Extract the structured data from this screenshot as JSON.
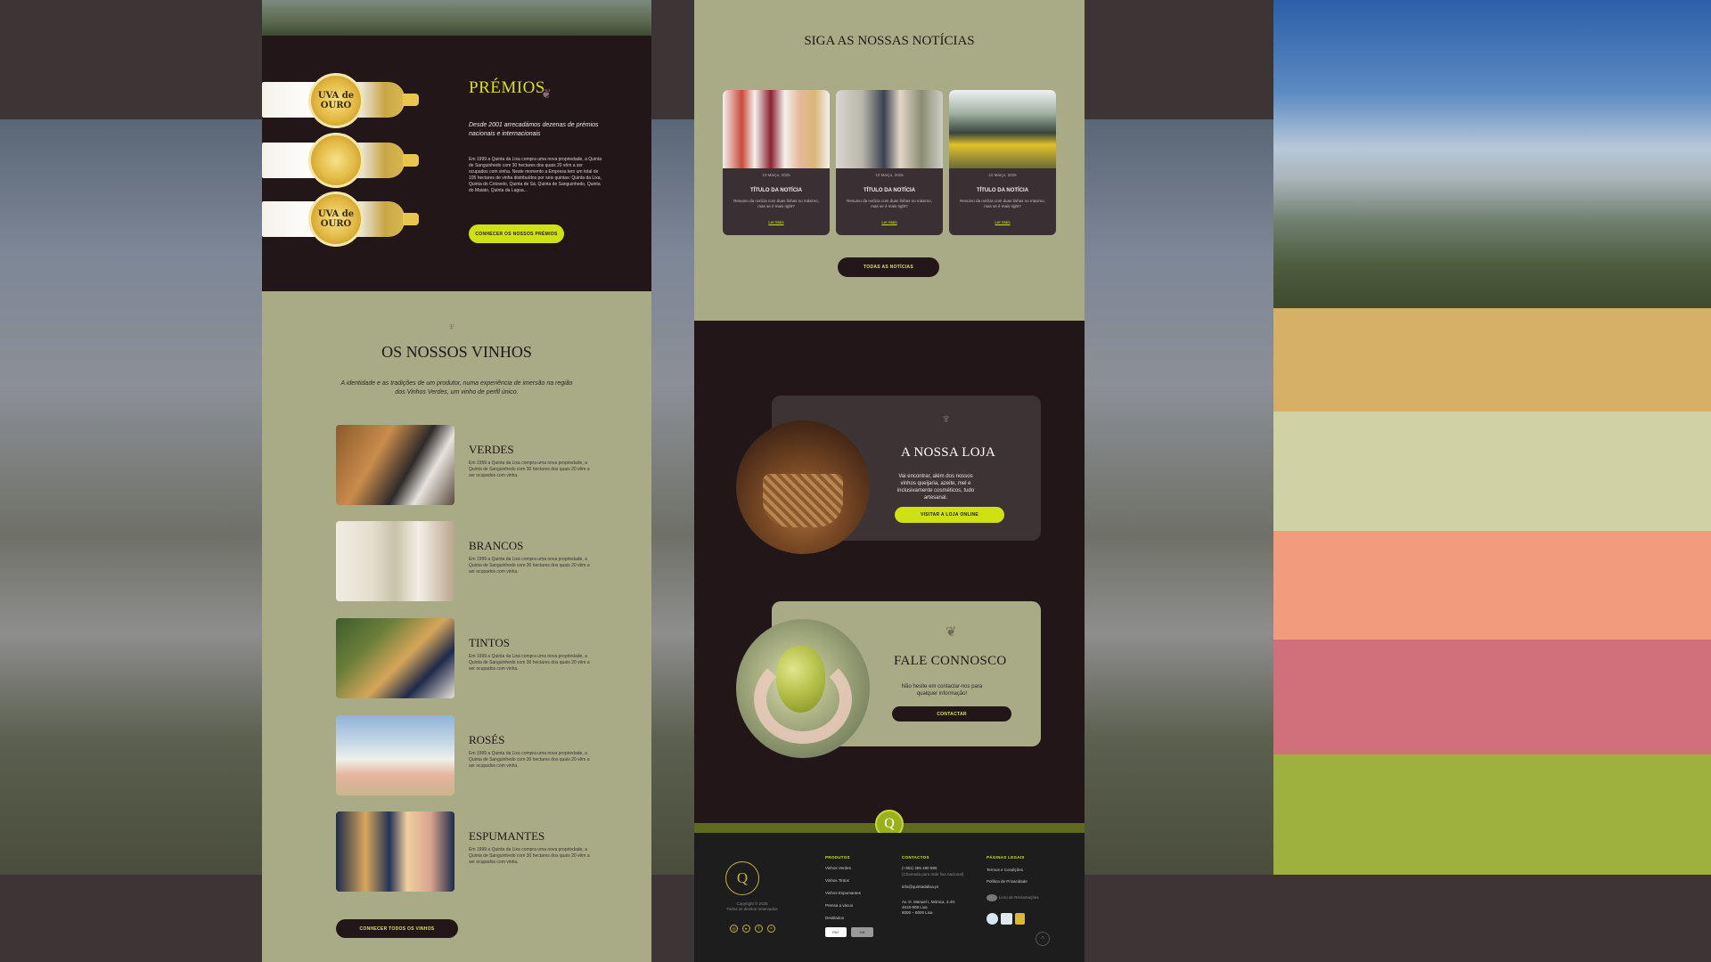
{
  "colors": {
    "dark": "#221619",
    "sage": "#a9aa86",
    "lime": "#cfe013",
    "palette": [
      "#d5b066",
      "#d0d2a5",
      "#f39b7d",
      "#d1707b",
      "#9eb03e"
    ]
  },
  "awards": {
    "medal_text": "UVA de OURO",
    "title": "PRÉMIOS",
    "lead": "Desde 2001 arrecadámos dezenas de prémios nacionais e internacionais",
    "body": "Em 1999 a Quinta da Lixa compra uma nova propriedade, a Quinta de Sanguinhedo com 30 hectares dos quais 20 vêm a ser ocupados com vinha. Neste momento a Empresa tem um total de 105 hectares de vinha distribuídos por seis quintas: Quinta da Lixa, Quinta do Cotovelo, Quinta de Sá, Quinta de Sanguinhedo, Quinta do Maiato, Quinta da Lagoa...",
    "button": "CONHECER OS NOSSOS PRÉMIOS"
  },
  "wines": {
    "title": "OS NOSSOS VINHOS",
    "lead": "A identidade e as tradições de um produtor, numa experiência de imersão na região dos Vinhos Verdes, um vinho de perfil único.",
    "items": [
      {
        "name": "VERDES",
        "desc": "Em 1999 a Quinta da Lixa compra uma nova propriedade, a Quinta de Sanguinhedo com 30 hectares dos quais 20 vêm a ser ocupados com vinha."
      },
      {
        "name": "BRANCOS",
        "desc": "Em 1999 a Quinta da Lixa compra uma nova propriedade, a Quinta de Sanguinhedo com 30 hectares dos quais 20 vêm a ser ocupados com vinha."
      },
      {
        "name": "TINTOS",
        "desc": "Em 1999 a Quinta da Lixa compra uma nova propriedade, a Quinta de Sanguinhedo com 30 hectares dos quais 20 vêm a ser ocupados com vinha."
      },
      {
        "name": "ROSÉS",
        "desc": "Em 1999 a Quinta da Lixa compra uma nova propriedade, a Quinta de Sanguinhedo com 30 hectares dos quais 20 vêm a ser ocupados com vinha."
      },
      {
        "name": "ESPUMANTES",
        "desc": "Em 1999 a Quinta da Lixa compra uma nova propriedade, a Quinta de Sanguinhedo com 30 hectares dos quais 20 vêm a ser ocupados com vinha."
      }
    ],
    "button": "CONHECER TODOS OS VINHOS"
  },
  "news": {
    "title": "SIGA AS NOSSAS NOTÍCIAS",
    "cards": [
      {
        "date": "10 Março, 2025",
        "title": "TÍTULO DA NOTÍCIA",
        "summary": "Resumo da notícia com duas linhas no máximo, mas se é mais right?",
        "more": "Ler Mais"
      },
      {
        "date": "10 Março, 2025",
        "title": "TÍTULO DA NOTÍCIA",
        "summary": "Resumo da notícia com duas linhas no máximo, mas se é mais right?",
        "more": "Ler Mais"
      },
      {
        "date": "10 Março, 2025",
        "title": "TÍTULO DA NOTÍCIA",
        "summary": "Resumo da notícia com duas linhas no máximo, mas se é mais right?",
        "more": "Ler Mais"
      }
    ],
    "button": "TODAS AS NOTÍCIAS"
  },
  "shop": {
    "title": "A NOSSA LOJA",
    "text": "Vai encontrar, além dos nossos vinhos queijaria, azeite, mel e inclusivamente cosméticos, tudo artesanal.",
    "button": "VISITAR A LOJA ONLINE"
  },
  "contact": {
    "title": "FALE CONNOSCO",
    "text": "Não hesite em contactar-nos para qualquer informação!",
    "button": "CONTACTAR"
  },
  "footer": {
    "badge": "Q",
    "logo": "Q",
    "copyright": "Copyright © 2025\nTodos os direitos reservados",
    "products_head": "PRODUTOS",
    "products": [
      "Vinhos Verdes",
      "Vinhos Tintos",
      "Vinhos Espumantes",
      "Prensa a vácuo",
      "Destilados"
    ],
    "contacts_head": "CONTACTOS",
    "contacts": [
      "(+351) 255 490 590",
      "(Chamada para rede fixa nacional)",
      "info@quintadalixa.pt",
      "Av. D. Manuel I, Mónica, 3.4G",
      "4615-908 Lixa",
      "8000 – 8000 Lixa"
    ],
    "legal_head": "PÁGINAS LEGAIS",
    "legal": [
      "Termos e Condições",
      "Política de Privacidade"
    ],
    "cert_text": "Livro de Reclamações",
    "pay_labels": [
      "PAY",
      "MB"
    ],
    "up_icon": "^"
  }
}
